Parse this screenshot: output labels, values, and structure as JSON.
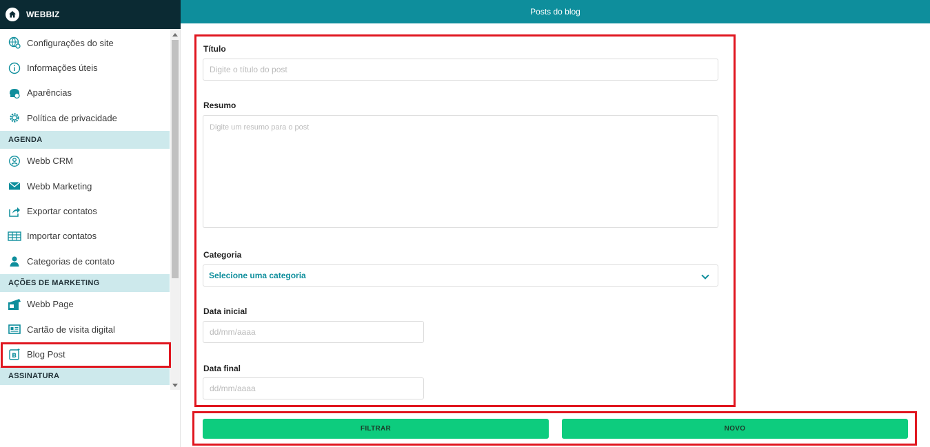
{
  "brand": {
    "title": "WEBBIZ",
    "icon": "home-icon"
  },
  "header": {
    "title": "Posts do blog"
  },
  "sidebar": {
    "group1": [
      {
        "label": "Configurações do site",
        "icon": "globe-gear-icon"
      },
      {
        "label": "Informações úteis",
        "icon": "info-icon"
      },
      {
        "label": "Aparências",
        "icon": "appearance-icon"
      },
      {
        "label": "Política de privacidade",
        "icon": "gear-icon"
      }
    ],
    "section_agenda": "AGENDA",
    "group2": [
      {
        "label": "Webb CRM",
        "icon": "crm-icon"
      },
      {
        "label": "Webb Marketing",
        "icon": "envelope-icon"
      },
      {
        "label": "Exportar contatos",
        "icon": "export-icon"
      },
      {
        "label": "Importar contatos",
        "icon": "table-icon"
      },
      {
        "label": "Categorias de contato",
        "icon": "person-icon"
      }
    ],
    "section_marketing": "AÇÕES DE MARKETING",
    "group3": [
      {
        "label": "Webb Page",
        "icon": "web-page-icon"
      },
      {
        "label": "Cartão de visita digital",
        "icon": "business-card-icon"
      },
      {
        "label": "Blog Post",
        "icon": "blog-icon"
      }
    ],
    "section_assinatura": "ASSINATURA"
  },
  "form": {
    "title_label": "Título",
    "title_placeholder": "Digite o título do post",
    "summary_label": "Resumo",
    "summary_placeholder": "Digite um resumo para o post",
    "category_label": "Categoria",
    "category_value": "Selecione uma categoria",
    "start_label": "Data inicial",
    "start_placeholder": "dd/mm/aaaa",
    "end_label": "Data final",
    "end_placeholder": "dd/mm/aaaa"
  },
  "actions": {
    "filter": "FILTRAR",
    "new": "NOVO"
  },
  "colors": {
    "brand_bg": "#0b2a33",
    "header_bg": "#0e8e9c",
    "section_bg": "#cde9ec",
    "button_bg": "#0dcc7e",
    "highlight": "#e0161f"
  }
}
